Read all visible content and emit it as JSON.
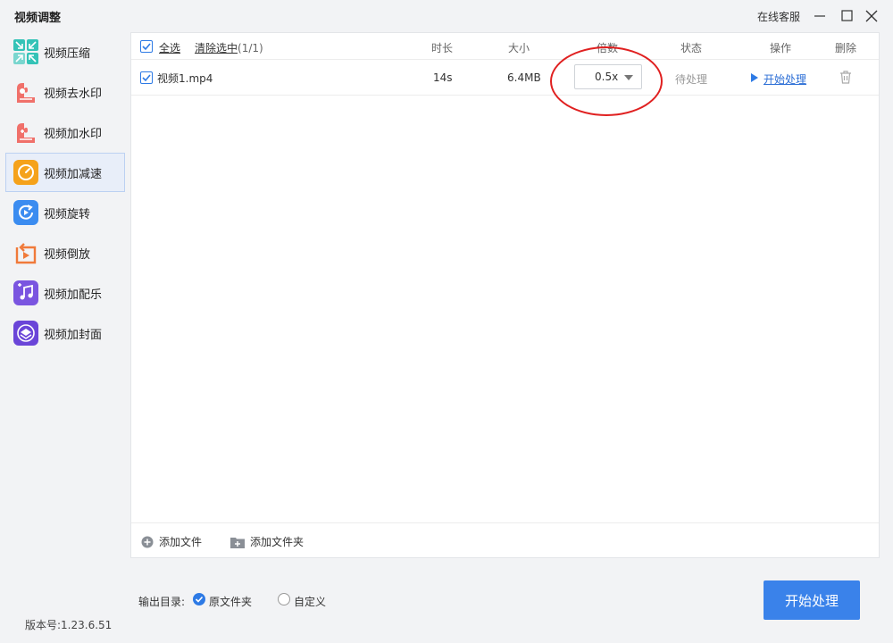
{
  "window": {
    "title": "视频调整",
    "support_label": "在线客服"
  },
  "sidebar": {
    "items": [
      {
        "label": "视频压缩",
        "icon": "compress-icon",
        "color": "#35c3b7"
      },
      {
        "label": "视频去水印",
        "icon": "remove-watermark-icon",
        "color": "#f0706a"
      },
      {
        "label": "视频加水印",
        "icon": "add-watermark-icon",
        "color": "#f0706a"
      },
      {
        "label": "视频加减速",
        "icon": "speed-icon",
        "color": "#f5a21b",
        "active": true
      },
      {
        "label": "视频旋转",
        "icon": "rotate-icon",
        "color": "#3b8cf0"
      },
      {
        "label": "视频倒放",
        "icon": "reverse-icon",
        "color": "#f07a3a"
      },
      {
        "label": "视频加配乐",
        "icon": "music-icon",
        "color": "#7a55e0"
      },
      {
        "label": "视频加封面",
        "icon": "cover-icon",
        "color": "#6a45d8"
      }
    ],
    "version": "版本号:1.23.6.51"
  },
  "table": {
    "select_all": "全选",
    "clear_selected": "清除选中",
    "selected_count": "(1/1)",
    "headers": {
      "duration": "时长",
      "size": "大小",
      "speed": "倍数",
      "status": "状态",
      "action": "操作",
      "delete": "删除"
    },
    "rows": [
      {
        "name": "视频1.mp4",
        "duration": "14s",
        "size": "6.4MB",
        "speed": "0.5x",
        "status": "待处理",
        "action": "开始处理"
      }
    ]
  },
  "footer": {
    "add_file": "添加文件",
    "add_folder": "添加文件夹"
  },
  "output": {
    "label": "输出目录:",
    "option_original": "原文件夹",
    "option_custom": "自定义",
    "selected": "原文件夹"
  },
  "start_button": "开始处理",
  "colors": {
    "accent": "#3a82ea",
    "highlight": "#e02020"
  }
}
